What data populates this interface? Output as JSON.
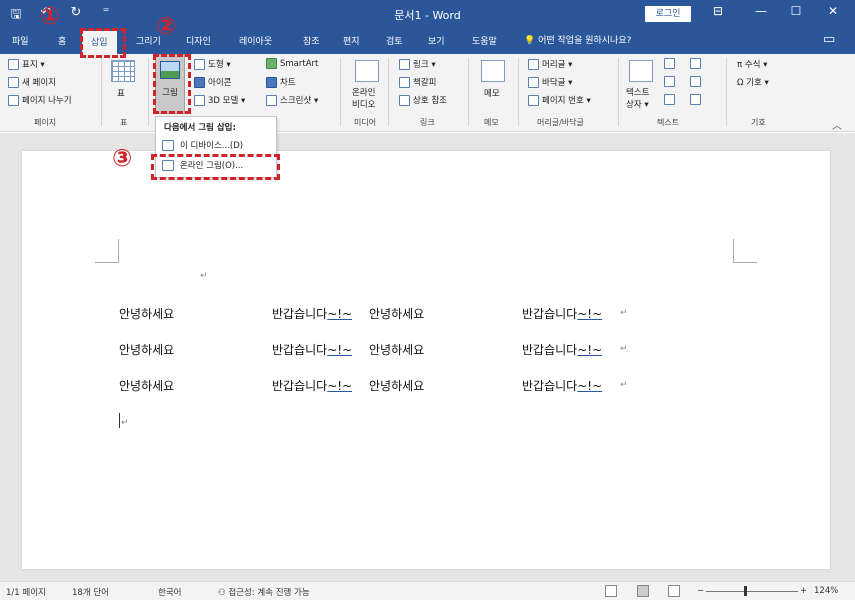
{
  "titlebar": {
    "doc_title": "문서1 - Word",
    "login": "로그인",
    "quick_save": "🖫",
    "quick_undo": "↶",
    "quick_redo": "↻",
    "quick_more": "⁼",
    "restore_ribbon": "⊟",
    "minimize": "—",
    "maximize": "☐",
    "close": "✕"
  },
  "tabs": {
    "file": "파일",
    "home": "홈",
    "insert": "삽입",
    "draw": "그리기",
    "design": "디자인",
    "layout": "레이아웃",
    "references": "참조",
    "mailings": "편지",
    "review": "검토",
    "view": "보기",
    "help": "도움말",
    "tell_me": "어떤 작업을 원하시나요?"
  },
  "ribbon": {
    "pages": {
      "cover": "표지 ▾",
      "blank": "새 페이지",
      "break": "페이지 나누기",
      "label": "페이지"
    },
    "tables": {
      "table": "표",
      "label": "표"
    },
    "illustrations": {
      "picture": "그림",
      "shapes": "도형 ▾",
      "icons": "아이콘",
      "model3d": "3D 모델 ▾",
      "smartart": "SmartArt",
      "chart": "차트",
      "screenshot": "스크린샷 ▾"
    },
    "media": {
      "online_video_l1": "온라인",
      "online_video_l2": "비디오",
      "label": "미디어"
    },
    "links": {
      "link": "링크 ▾",
      "bookmark": "책갈피",
      "crossref": "상호 참조",
      "label": "링크"
    },
    "comments": {
      "comment": "메모",
      "label": "메모"
    },
    "header_footer": {
      "header": "머리글 ▾",
      "footer": "바닥글 ▾",
      "page_number": "페이지 번호 ▾",
      "label": "머리글/바닥글"
    },
    "text": {
      "textbox_l1": "텍스트",
      "textbox_l2": "상자 ▾",
      "label": "텍스트"
    },
    "symbols": {
      "equation": "π 수식 ▾",
      "symbol": "Ω 기호 ▾",
      "label": "기호"
    }
  },
  "dropdown": {
    "title": "다음에서 그림 삽입:",
    "this_device": "이 디바이스...(D)",
    "online_pictures": "온라인 그림(O)..."
  },
  "callouts": {
    "one": "①",
    "two": "②",
    "three": "③"
  },
  "document": {
    "rows": [
      {
        "c1": "안녕하세요",
        "c2": "반갑습니다",
        "t2": "~!~",
        "c3": "안녕하세요",
        "c4": "반갑습니다",
        "t4": "~!~"
      },
      {
        "c1": "안녕하세요",
        "c2": "반갑습니다",
        "t2": "~!~",
        "c3": "안녕하세요",
        "c4": "반갑습니다",
        "t4": "~!~"
      },
      {
        "c1": "안녕하세요",
        "c2": "반갑습니다",
        "t2": "~!~",
        "c3": "안녕하세요",
        "c4": "반갑습니다",
        "t4": "~!~"
      }
    ],
    "para_mark": "↵"
  },
  "status": {
    "page": "1/1 페이지",
    "words": "18개 단어",
    "language": "한국어",
    "accessibility": "접근성: 계속 진행 가능",
    "zoom_minus": "−",
    "zoom_plus": "+",
    "zoom": "124%",
    "zoom_level": 0.43
  }
}
